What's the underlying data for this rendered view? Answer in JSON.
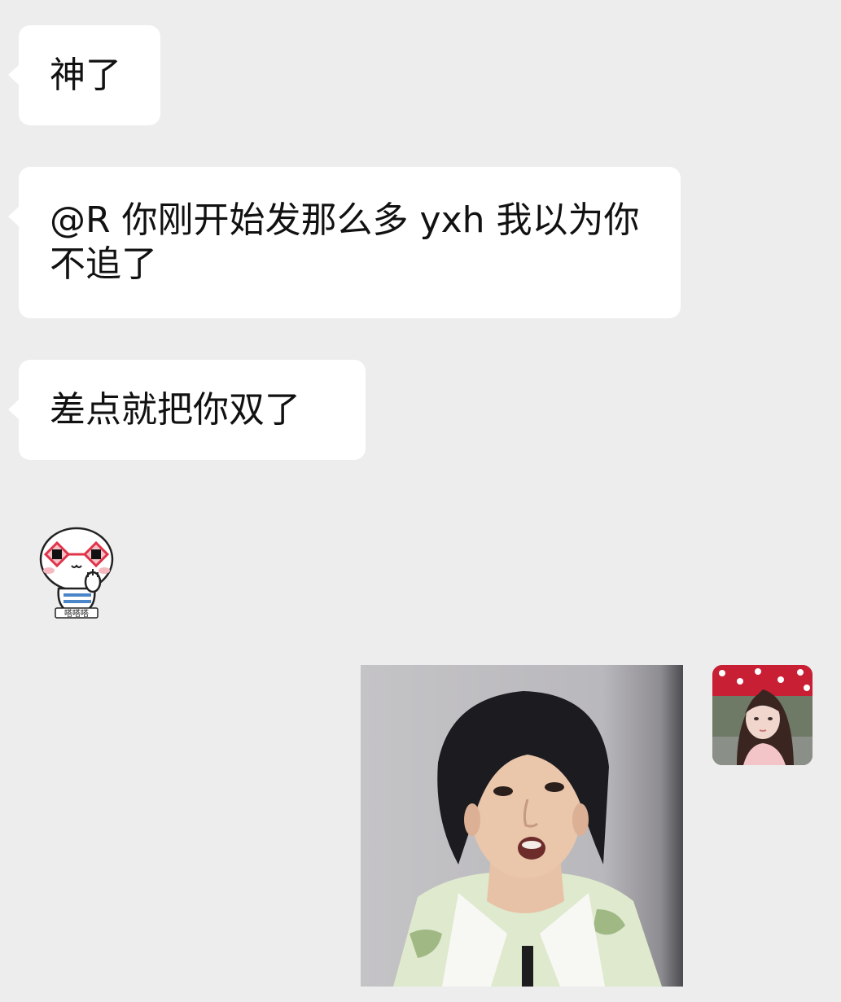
{
  "chat": {
    "messages": [
      {
        "side": "left",
        "type": "text",
        "text": "神了"
      },
      {
        "side": "left",
        "type": "text",
        "text": "@R 你刚开始发那么多 yxh 我以为你不追了"
      },
      {
        "side": "left",
        "type": "text",
        "text": "差点就把你双了"
      },
      {
        "side": "left",
        "type": "sticker",
        "icon": "cartoon-sticker-icon",
        "caption": "嗒嗒嗒"
      },
      {
        "side": "right",
        "type": "image",
        "icon": "surprised-face-photo"
      }
    ],
    "self_avatar": {
      "icon": "user-avatar"
    }
  },
  "colors": {
    "background": "#ededed",
    "bubble_left": "#ffffff",
    "text": "#111111"
  }
}
